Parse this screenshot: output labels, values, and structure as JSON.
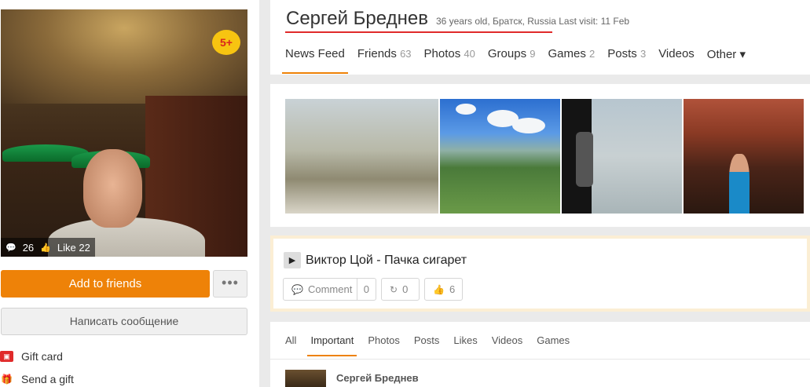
{
  "profile": {
    "name": "Сергей Бреднев",
    "meta": "36 years old, Братск, Russia Last visit: 11 Feb",
    "age_badge": "5+",
    "comments_count": "26",
    "likes_label": "Like 22"
  },
  "actions": {
    "add_friends": "Add to friends",
    "more": "•••",
    "message": "Написать сообщение"
  },
  "side_links": [
    {
      "label": "Gift card",
      "icon": "gift-card-icon"
    },
    {
      "label": "Send a gift",
      "icon": "send-gift-icon"
    }
  ],
  "tabs": [
    {
      "label": "News Feed",
      "count": ""
    },
    {
      "label": "Friends",
      "count": "63"
    },
    {
      "label": "Photos",
      "count": "40"
    },
    {
      "label": "Groups",
      "count": "9"
    },
    {
      "label": "Games",
      "count": "2"
    },
    {
      "label": "Posts",
      "count": "3"
    },
    {
      "label": "Videos",
      "count": ""
    },
    {
      "label": "Other ▾",
      "count": ""
    }
  ],
  "music": {
    "title": "Виктор Цой - Пачка сигарет",
    "comment_label": "Comment",
    "comment_count": "0",
    "share_count": "0",
    "like_count": "6"
  },
  "feed_tabs": [
    "All",
    "Important",
    "Photos",
    "Posts",
    "Likes",
    "Videos",
    "Games"
  ],
  "post": {
    "author": "Сергей Бреднев"
  },
  "colors": {
    "accent_orange": "#ee8208",
    "name_underline_red": "#e02a2a",
    "age_badge_yellow": "#f7c411"
  }
}
